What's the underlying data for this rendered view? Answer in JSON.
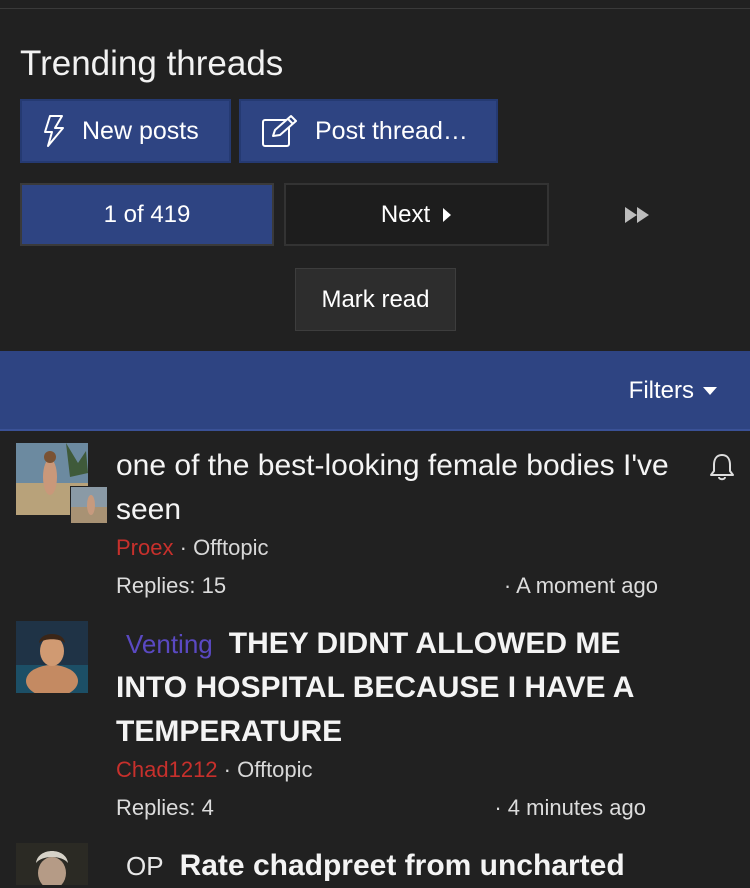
{
  "page": {
    "title": "Trending threads"
  },
  "buttons": {
    "new_posts": "New posts",
    "post_thread": "Post thread…"
  },
  "pagination": {
    "current": "1 of 419",
    "next": "Next"
  },
  "mark_read": "Mark read",
  "filters": {
    "label": "Filters"
  },
  "threads": [
    {
      "prefix": "",
      "title": "one of the best-looking female bodies I've seen",
      "author": "Proex",
      "forum": "Offtopic",
      "replies": "Replies: 15",
      "time": "A moment ago"
    },
    {
      "prefix": "Venting",
      "title": "THEY DIDNT ALLOWED ME INTO HOSPITAL BECAUSE I HAVE A TEMPERATURE",
      "author": "Chad1212",
      "forum": "Offtopic",
      "replies": "Replies: 4",
      "time": "4 minutes ago"
    },
    {
      "prefix": "OP",
      "title": "Rate chadpreet from uncharted",
      "author": "",
      "forum": "",
      "replies": "",
      "time": ""
    }
  ],
  "separators": {
    "dot": "·"
  },
  "colors": {
    "accent": "#2e4482",
    "background": "#212121",
    "author": "#c7302c",
    "venting": "#5a49c2"
  }
}
